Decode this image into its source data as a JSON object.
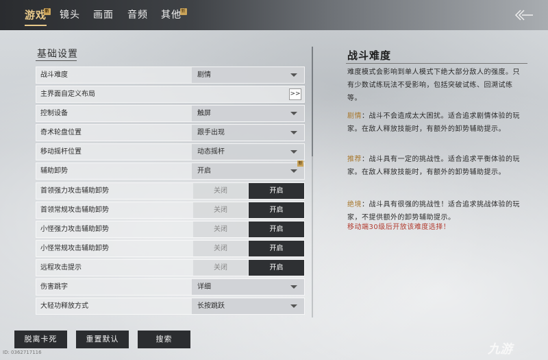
{
  "tabs": [
    {
      "label": "游戏",
      "active": true,
      "badge": "新"
    },
    {
      "label": "镜头",
      "active": false
    },
    {
      "label": "画面",
      "active": false
    },
    {
      "label": "音频",
      "active": false
    },
    {
      "label": "其他",
      "active": false,
      "badge": "新"
    }
  ],
  "left": {
    "section_title": "基础设置",
    "rows": [
      {
        "label": "战斗难度",
        "type": "dropdown",
        "value": "剧情"
      },
      {
        "label": "主界面自定义布局",
        "type": "button",
        "button": ">>"
      },
      {
        "label": "控制设备",
        "type": "dropdown",
        "value": "触屏"
      },
      {
        "label": "奇术轮盘位置",
        "type": "dropdown",
        "value": "跟手出现"
      },
      {
        "label": "移动摇杆位置",
        "type": "dropdown",
        "value": "动态摇杆"
      },
      {
        "label": "辅助卸势",
        "type": "dropdown",
        "value": "开启",
        "badge": "新"
      },
      {
        "label": "首领强力攻击辅助卸势",
        "type": "toggle",
        "off": "关闭",
        "on": "开启"
      },
      {
        "label": "首领常规攻击辅助卸势",
        "type": "toggle",
        "off": "关闭",
        "on": "开启"
      },
      {
        "label": "小怪强力攻击辅助卸势",
        "type": "toggle",
        "off": "关闭",
        "on": "开启"
      },
      {
        "label": "小怪常规攻击辅助卸势",
        "type": "toggle",
        "off": "关闭",
        "on": "开启"
      },
      {
        "label": "远程攻击提示",
        "type": "toggle",
        "off": "关闭",
        "on": "开启"
      },
      {
        "label": "伤害跳字",
        "type": "dropdown",
        "value": "详细"
      },
      {
        "label": "大轻功释放方式",
        "type": "dropdown",
        "value": "长按跳跃"
      }
    ]
  },
  "right": {
    "title": "战斗难度",
    "intro": "难度模式会影响到单人模式下绝大部分敌人的强度。只有少数试练玩法不受影响，包括突破试练、回溯试练等。",
    "items": [
      {
        "name": "剧情",
        "sep": "：",
        "text": "战斗不会造成太大困扰。适合追求剧情体验的玩家。在敌人释放技能时，有额外的卸势辅助提示。"
      },
      {
        "name": "推荐",
        "sep": "：",
        "text": "战斗具有一定的挑战性。适合追求平衡体验的玩家。在敌人释放技能时，有额外的卸势辅助提示。"
      },
      {
        "name": "绝境",
        "sep": "：",
        "text": "战斗具有很强的挑战性！适合追求挑战体验的玩家，不提供额外的卸势辅助提示。"
      }
    ],
    "warning": "移动端30级后开放该难度选择！"
  },
  "bottom": {
    "buttons": [
      "脱离卡死",
      "重置默认",
      "搜索"
    ],
    "uid": "ID: 0362717116",
    "logo": "九游"
  },
  "colors": {
    "accent_gold": "#e8c98a",
    "dark_button": "#2e3033",
    "warning_red": "#b23b2f"
  }
}
